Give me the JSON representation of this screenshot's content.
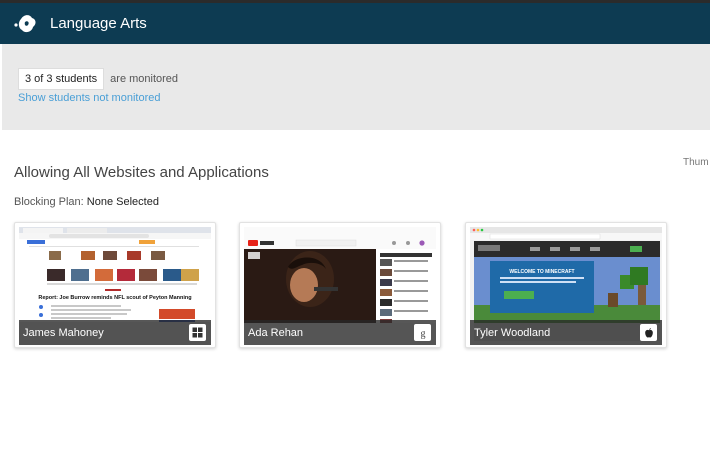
{
  "header": {
    "class_title": "Language Arts",
    "logo_icon": "hands-logo-icon"
  },
  "monitoring": {
    "count_label": "3 of 3 students",
    "count_suffix": "are monitored",
    "show_link": "Show students not monitored"
  },
  "policy": {
    "title": "Allowing All Websites and Applications",
    "blocking_label": "Blocking Plan:",
    "blocking_value": "None Selected"
  },
  "view_toggle_label": "Thum",
  "students": [
    {
      "name": "James Mahoney",
      "os_icon": "windows-icon",
      "screen": {
        "headline": "Report: Joe Burrow reminds NFL scout of Peyton Manning"
      }
    },
    {
      "name": "Ada Rehan",
      "os_icon": "chrome-os-icon",
      "screen": {}
    },
    {
      "name": "Tyler Woodland",
      "os_icon": "apple-icon",
      "screen": {
        "headline": "WELCOME TO MINECRAFT"
      }
    }
  ],
  "colors": {
    "header_bg": "#0d3b52",
    "panel_bg": "#e9e9e9",
    "link": "#4a9fd6"
  }
}
